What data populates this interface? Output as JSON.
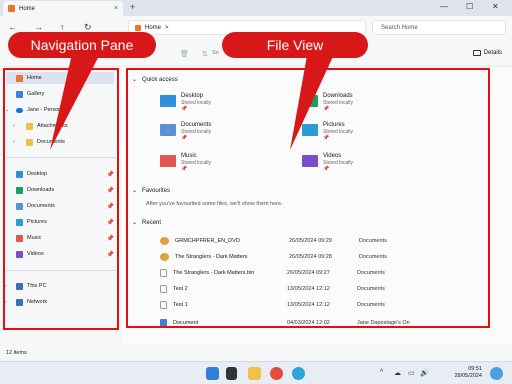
{
  "window": {
    "tab_title": "Home",
    "tab_close": "×",
    "new_tab": "+",
    "minimize": "—",
    "maximize": "☐",
    "close": "✕"
  },
  "address_bar": {
    "path": "Home",
    "separator": ">",
    "search_placeholder": "Search Home"
  },
  "command_bar": {
    "sort_label": "So",
    "details_label": "Details"
  },
  "nav_pane": {
    "items": [
      {
        "label": "Home",
        "icon": "home-icon",
        "color": "#e8772e"
      },
      {
        "label": "Gallery",
        "icon": "gallery-icon",
        "color": "#3b82d6"
      },
      {
        "label": "Jane - Personal",
        "icon": "onedrive-icon",
        "color": "#1478d4"
      },
      {
        "label": "Attachments",
        "icon": "folder-icon",
        "color": "#f1c04a"
      },
      {
        "label": "Documents",
        "icon": "folder-icon",
        "color": "#f1c04a"
      }
    ],
    "pinned": [
      {
        "label": "Desktop",
        "icon": "desktop-icon",
        "color": "#2f8fd8"
      },
      {
        "label": "Downloads",
        "icon": "downloads-icon",
        "color": "#1aa160"
      },
      {
        "label": "Documents",
        "icon": "documents-icon",
        "color": "#5e8fd0"
      },
      {
        "label": "Pictures",
        "icon": "pictures-icon",
        "color": "#2b9ad6"
      },
      {
        "label": "Music",
        "icon": "music-icon",
        "color": "#e0574f"
      },
      {
        "label": "Videos",
        "icon": "videos-icon",
        "color": "#7b4fc9"
      }
    ],
    "bottom": [
      {
        "label": "This PC",
        "icon": "pc-icon",
        "color": "#3b6fb6"
      },
      {
        "label": "Network",
        "icon": "network-icon",
        "color": "#3b6fb6"
      }
    ]
  },
  "file_view": {
    "quick_access_title": "Quick access",
    "quick_access": [
      {
        "name": "Desktop",
        "sub": "Stored locally",
        "color": "#2f8fd8"
      },
      {
        "name": "Downloads",
        "sub": "Stored locally",
        "color": "#1aa160"
      },
      {
        "name": "Documents",
        "sub": "Stored locally",
        "color": "#5e8fd0"
      },
      {
        "name": "Pictures",
        "sub": "Stored locally",
        "color": "#2b9ad6"
      },
      {
        "name": "Music",
        "sub": "Stored locally",
        "color": "#e0574f"
      },
      {
        "name": "Videos",
        "sub": "Stored locally",
        "color": "#7b4fc9"
      }
    ],
    "favourites_title": "Favourites",
    "favourites_empty": "After you've favourited some files, we'll show them here.",
    "recent_title": "Recent",
    "recent": [
      {
        "name": "GRMCHPFRER_EN_DVD",
        "date": "26/05/2024 09:29",
        "location": "Documents",
        "color": "#e0a040"
      },
      {
        "name": "The Stranglers - Dark Matters",
        "date": "26/05/2024 09:28",
        "location": "Documents",
        "color": "#e0a040"
      },
      {
        "name": "The Stranglers - Dark Matters.bin",
        "date": "26/05/2024 09:27",
        "location": "Documents",
        "color": "#dcdcdc"
      },
      {
        "name": "Test 2",
        "date": "13/05/2024 12:12",
        "location": "Documents",
        "color": "#dcdcdc"
      },
      {
        "name": "Test 1",
        "date": "13/05/2024 12:12",
        "location": "Documents",
        "color": "#dcdcdc"
      },
      {
        "name": "Document",
        "date": "04/03/2024 12:02",
        "location": "Jane Dapostage's On",
        "color": "#3b82d6"
      }
    ]
  },
  "status_bar": {
    "count": "12 items"
  },
  "taskbar": {
    "time": "09:51",
    "date": "28/05/2024",
    "tray_chevron": "^"
  },
  "annotations": {
    "nav_label": "Navigation Pane",
    "file_label": "File View"
  }
}
